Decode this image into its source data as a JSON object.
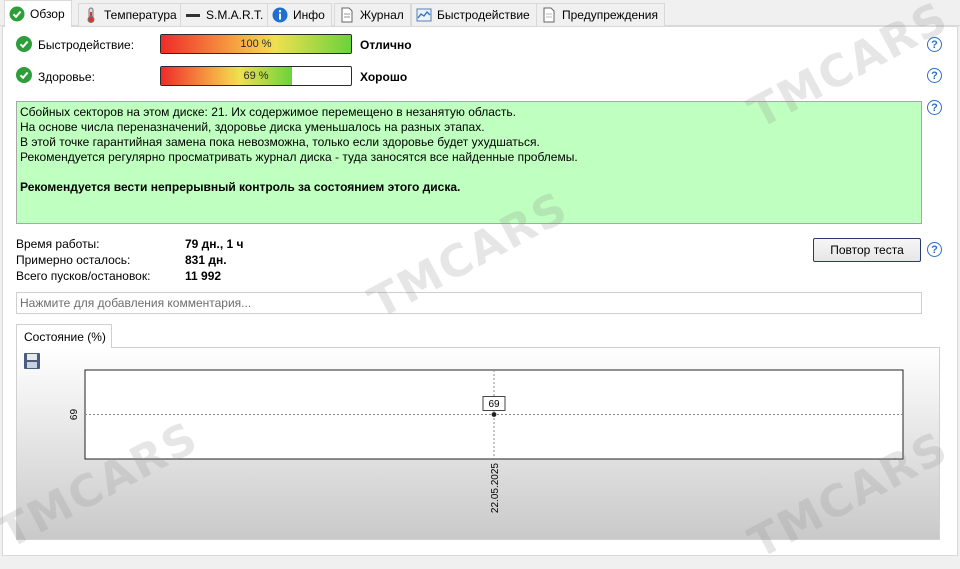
{
  "tabs": [
    {
      "label": "Обзор",
      "icon": "green-check-icon"
    },
    {
      "label": "Температура",
      "icon": "thermometer-icon"
    },
    {
      "label": "S.M.A.R.T.",
      "icon": "dash-icon"
    },
    {
      "label": "Инфо",
      "icon": "info-icon"
    },
    {
      "label": "Журнал",
      "icon": "document-icon"
    },
    {
      "label": "Быстродействие",
      "icon": "performance-chart-icon"
    },
    {
      "label": "Предупреждения",
      "icon": "warnings-icon"
    }
  ],
  "performance": {
    "label": "Быстродействие:",
    "value": 100,
    "text": "100 %",
    "verdict": "Отлично"
  },
  "health": {
    "label": "Здоровье:",
    "value": 69,
    "text": "69 %",
    "verdict": "Хорошо"
  },
  "message": {
    "lines": [
      "Сбойных секторов на этом диске: 21. Их содержимое перемещено в незанятую область.",
      "На основе числа переназначений, здоровье диска уменьшалось на разных этапах.",
      "В этой точке гарантийная замена пока невозможна, только если здоровье будет ухудшаться.",
      "Рекомендуется регулярно просматривать журнал диска - туда заносятся все найденные проблемы."
    ],
    "bold": "Рекомендуется вести непрерывный контроль за состоянием этого диска."
  },
  "stats": {
    "uptime_label": "Время работы:",
    "uptime": "79 дн., 1 ч",
    "remaining_label": "Примерно осталось:",
    "remaining": "831 дн.",
    "starts_label": "Всего пусков/остановок:",
    "starts": "11 992"
  },
  "retest_button": "Повтор теста",
  "comment_placeholder": "Нажмите для добавления комментария...",
  "chart_tab": "Состояние (%)",
  "chart_data": {
    "type": "scatter",
    "title": "Состояние (%)",
    "x": [
      "22.05.2025"
    ],
    "series": [
      {
        "values": [
          69
        ]
      }
    ],
    "y_tick_labels": [
      "69"
    ],
    "x_tick_labels": [
      "22.05.2025"
    ],
    "data_labels": [
      "69"
    ],
    "grid": true
  },
  "watermark": "TMCARS",
  "colors": {
    "message_bg": "#bfffbf",
    "check": "#2e9e3a",
    "help": "#2a6fc9"
  }
}
